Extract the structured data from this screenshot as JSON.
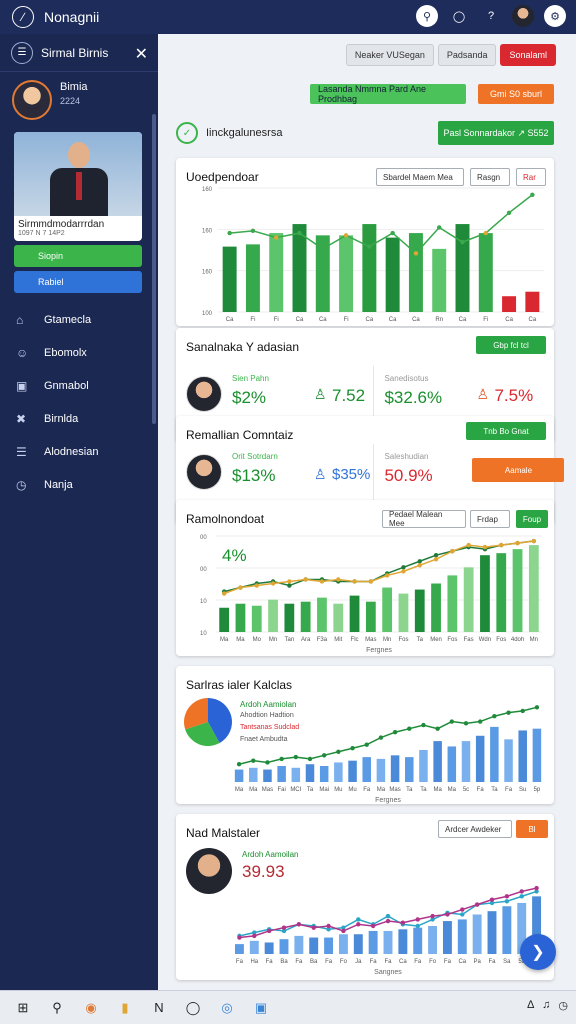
{
  "app": {
    "title": "Nonagnii"
  },
  "topbar": {
    "icons": [
      "bell-icon",
      "chat-icon",
      "help-icon",
      "avatar",
      "settings-icon"
    ]
  },
  "sidebar": {
    "title": "Sirmal Birnis",
    "user": {
      "name": "Bimia",
      "sub": "2224"
    },
    "profile": {
      "name": "Sirmmdmodarrrdan",
      "id": "1097 N 7 14P2"
    },
    "buttons": [
      {
        "label": "Siopin"
      },
      {
        "label": "Rabiel"
      }
    ],
    "items": [
      {
        "label": "Gtamecla",
        "icon": "home-icon"
      },
      {
        "label": "Ebomolx",
        "icon": "people-icon"
      },
      {
        "label": "Gnmabol",
        "icon": "image-icon"
      },
      {
        "label": "Birnlda",
        "icon": "tools-icon"
      },
      {
        "label": "Alodnesian",
        "icon": "layers-icon"
      },
      {
        "label": "Nanja",
        "icon": "clock-icon"
      }
    ]
  },
  "header": {
    "tabs": [
      "Neaker VUSegan",
      "Padsanda",
      "Sonalaml"
    ],
    "btn_green": "Lasanda Nmmna Pard Ane Prodhbag",
    "btn_orange": "Gmi S0 sburl",
    "feature_label": "Iinckgalunesrsa",
    "feature_btn": "Pasl Sonnardakor  ↗  S552"
  },
  "card1": {
    "title": "Uoedpendoar",
    "select1": "Sbardel Maem Mea",
    "select2": "Rasgn",
    "select3": "Rar",
    "chart_data": {
      "type": "bar",
      "categories": [
        "Ca",
        "Fi",
        "Fi",
        "Ca",
        "Ca",
        "Fi",
        "Ca",
        "Ca",
        "Ca",
        "Rn",
        "Ca",
        "Fi",
        "Ca",
        "Ca",
        "Fi",
        "Ca"
      ],
      "ylabels": [
        "160",
        "160",
        "160",
        "100"
      ],
      "series": [
        {
          "type": "bar",
          "values": [
            58,
            60,
            70,
            78,
            68,
            68,
            78,
            66,
            70,
            56,
            78,
            70,
            14,
            18
          ]
        },
        {
          "type": "line",
          "values": [
            70,
            72,
            66,
            70,
            56,
            68,
            58,
            70,
            52,
            75,
            62,
            70,
            88,
            104
          ]
        }
      ]
    }
  },
  "kpi1": {
    "title": "Sanalnaka Y adasian",
    "chip": "Gbp fcl tcl",
    "items": [
      {
        "label": "Sien Pahn",
        "value": "$2%",
        "icon": "person-chart-icon",
        "value2": "7.52"
      },
      {
        "label": "Sanedisotus",
        "value": "$32.6%",
        "icon": "person-chart-icon",
        "value2": "7.5%"
      }
    ]
  },
  "kpi2": {
    "title": "Remallian Comntaiz",
    "chip": "Tnb Bo Gnat",
    "items": [
      {
        "label": "Orit Sotrdarn",
        "value": "$13%",
        "value2": "$35%"
      },
      {
        "label": "Saleshudian",
        "value": "50.9%"
      }
    ],
    "orange_btn": "Aamale"
  },
  "card2": {
    "title": "Ramolnondoat",
    "select1": "Pedael Malean Mee",
    "select2": "Frdap",
    "select3": "Foup",
    "big_value": "4%",
    "xlabel": "Fergnes",
    "chart_data": {
      "type": "bar",
      "categories": [
        "Ma",
        "Ma",
        "Mo",
        "Mn",
        "Tan",
        "Ara",
        "F3a",
        "Mit",
        "Flc",
        "Mas",
        "Mn",
        "Fos",
        "Ta",
        "Men",
        "Fos",
        "Fas",
        "Wdn",
        "Fos",
        "4doh",
        "Mn"
      ],
      "ylabels": [
        "00",
        "00",
        "10",
        "10"
      ],
      "series": [
        {
          "type": "bar",
          "values": [
            24,
            28,
            26,
            32,
            28,
            30,
            34,
            28,
            36,
            30,
            44,
            38,
            42,
            48,
            56,
            64,
            76,
            78,
            82,
            86
          ]
        },
        {
          "type": "line",
          "values": [
            40,
            44,
            48,
            50,
            46,
            52,
            52,
            50,
            50,
            50,
            58,
            64,
            70,
            76,
            80,
            84,
            82,
            86,
            88,
            90
          ]
        },
        {
          "type": "line",
          "values": [
            38,
            44,
            46,
            48,
            50,
            52,
            50,
            52,
            50,
            50,
            56,
            60,
            66,
            72,
            80,
            86,
            84,
            86,
            88,
            90
          ]
        }
      ]
    }
  },
  "card3": {
    "title": "Sarlras ialer Kalclas",
    "legend_title": "Ardoh Aamiolan",
    "legend_items": [
      "Ahodtion Hadtion",
      "Tantsanas Sudclad",
      "Fnaet Ambudta"
    ],
    "xlabel": "Fergnes",
    "chart_data": {
      "type": "bar",
      "categories": [
        "Ma",
        "Ma",
        "Mas",
        "Fai",
        "MCI",
        "Ta",
        "Mai",
        "Mu",
        "Mu",
        "Fa",
        "Ma",
        "Mas",
        "Ta",
        "Ta",
        "Ma",
        "Ma",
        "5c",
        "Fa",
        "Ta",
        "Fa",
        "Su",
        "5p"
      ],
      "series": [
        {
          "type": "bar",
          "values": [
            14,
            16,
            14,
            18,
            16,
            20,
            18,
            22,
            24,
            28,
            26,
            30,
            28,
            36,
            46,
            40,
            46,
            52,
            62,
            48,
            58,
            60
          ]
        },
        {
          "type": "line",
          "values": [
            20,
            24,
            22,
            26,
            28,
            26,
            30,
            34,
            38,
            42,
            50,
            56,
            60,
            64,
            60,
            68,
            66,
            68,
            74,
            78,
            80,
            84
          ]
        }
      ],
      "pie": [
        0.42,
        0.28,
        0.3
      ]
    }
  },
  "card4": {
    "title": "Nad Malstaler",
    "select1": "Ardcer Awdeker",
    "select2": "Bl",
    "legend_title": "Ardoh Aamoilan",
    "big_value": "39.93",
    "xlabel": "Sangnes",
    "chart_data": {
      "type": "bar",
      "categories": [
        "Fa",
        "Ha",
        "Fa",
        "Ba",
        "Fa",
        "Ba",
        "Fa",
        "Fo",
        "Ja",
        "Fa",
        "Fa",
        "Ca",
        "Fa",
        "Fo",
        "Fa",
        "Ca",
        "Pa",
        "Fa",
        "Sa",
        "5a"
      ],
      "series": [
        {
          "type": "bar",
          "values": [
            12,
            16,
            14,
            18,
            22,
            20,
            20,
            24,
            24,
            28,
            28,
            30,
            32,
            34,
            40,
            42,
            48,
            52,
            58,
            62,
            70
          ]
        },
        {
          "type": "line",
          "values": [
            22,
            26,
            30,
            28,
            36,
            34,
            30,
            32,
            42,
            36,
            46,
            36,
            34,
            42,
            50,
            48,
            60,
            62,
            64,
            70,
            76
          ]
        },
        {
          "type": "line",
          "values": [
            20,
            22,
            28,
            32,
            36,
            32,
            34,
            28,
            36,
            34,
            40,
            38,
            42,
            46,
            48,
            54,
            60,
            66,
            70,
            76,
            80
          ]
        }
      ]
    }
  },
  "colors": {
    "accent": "#2aa544",
    "brand": "#1d2c5a",
    "orange": "#ee7326",
    "blue": "#2a63d6",
    "red": "#d9282f"
  },
  "taskbar": {
    "icons": [
      "windows-icon",
      "search-icon",
      "browser-icon",
      "folder-icon",
      "app-icon",
      "task-icon",
      "chrome-icon",
      "store-icon"
    ]
  }
}
